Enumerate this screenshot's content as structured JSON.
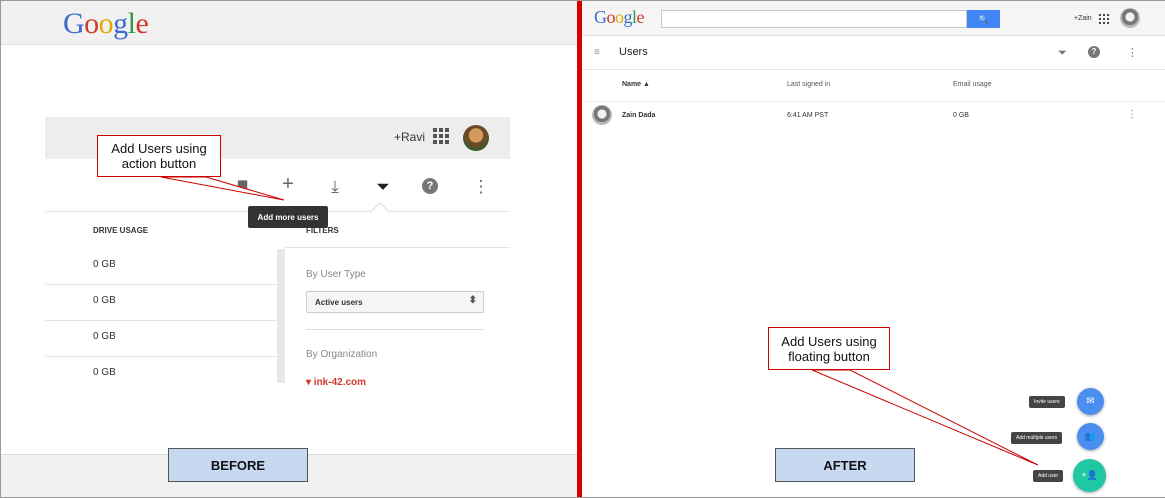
{
  "before": {
    "label": "BEFORE",
    "logo": [
      "G",
      "o",
      "o",
      "g",
      "l",
      "e"
    ],
    "header_user": "+Ravi",
    "toolbar": {
      "chart_icon": "▮▮",
      "add_icon": "+",
      "download_icon": "⤓",
      "filter_icon": "⏷",
      "help_icon": "?",
      "more_icon": "⋮"
    },
    "tooltip": "Add more users",
    "column_header": "DRIVE USAGE",
    "filters_header": "FILTERS",
    "rows": [
      "0 GB",
      "0 GB",
      "0 GB",
      "0 GB"
    ],
    "by_user_type": "By User Type",
    "user_type_select": "Active users",
    "by_organization": "By Organization",
    "organization": "▾ ink-42.com",
    "callout": "Add Users using\naction button"
  },
  "after": {
    "label": "AFTER",
    "logo": [
      "G",
      "o",
      "o",
      "g",
      "l",
      "e"
    ],
    "search_icon": "🔍",
    "header_user": "+Zain",
    "page_title": "Users",
    "menu_icon": "≡",
    "filter_icon": "⏷",
    "help_icon": "?",
    "more_icon": "⋮",
    "columns": {
      "name": "Name ▲",
      "last_signed_in": "Last signed in",
      "email_usage": "Email usage"
    },
    "user_row": {
      "name": "Zain Dada",
      "last_signed_in": "6:41 AM PST",
      "email_usage": "0 GB"
    },
    "fab_actions": [
      {
        "label": "Invite users",
        "icon": "✉",
        "color": "#4a8ef0"
      },
      {
        "label": "Add multiple users",
        "icon": "👥",
        "color": "#4a8ef0"
      },
      {
        "label": "Add user",
        "icon": "+👤",
        "color": "#1fc7a2"
      }
    ],
    "callout": "Add Users using\nfloating button"
  },
  "colors": {
    "divider": "#d50000",
    "fab_primary": "#1fc7a2",
    "fab_secondary": "#4a8ef0",
    "label_bg": "#c6d9f1"
  }
}
